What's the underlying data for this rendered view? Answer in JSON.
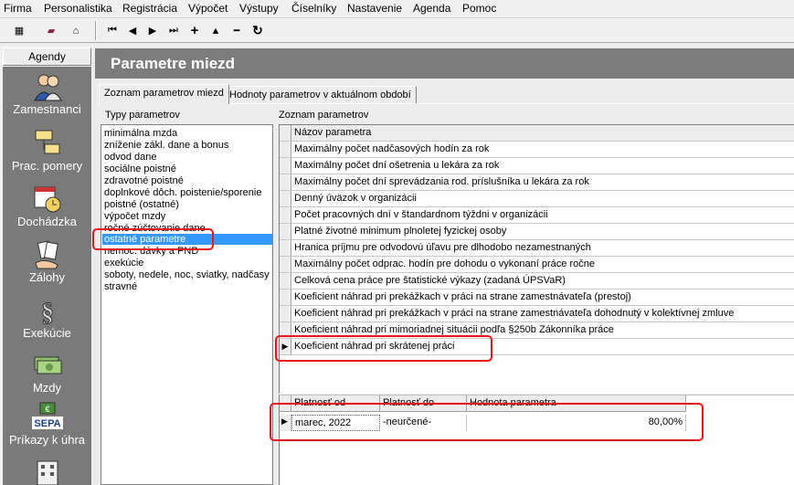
{
  "menu": [
    "Firma",
    "Personalistika",
    "Registrácia",
    "Výpočet",
    "Výstupy",
    "Číselníky",
    "Nastavenie",
    "Agenda",
    "Pomoc"
  ],
  "toolbar": {
    "icons": [
      "calculator-icon",
      "book-icon",
      "home-icon",
      "first-record-icon",
      "prev-record-icon",
      "next-record-icon",
      "last-record-icon",
      "add-icon",
      "up-icon",
      "delete-icon",
      "refresh-icon"
    ],
    "glyphs": [
      "▦",
      "▰",
      "⌂",
      "⏮",
      "◀",
      "▶",
      "⏭",
      "+",
      "▲",
      "━",
      "↻"
    ]
  },
  "sidebar": {
    "header": "Agendy",
    "items": [
      {
        "label": "Zamestnanci",
        "icon": "people-icon"
      },
      {
        "label": "Prac. pomery",
        "icon": "org-chart-icon"
      },
      {
        "label": "Dochádzka",
        "icon": "calendar-clock-icon"
      },
      {
        "label": "Zálohy",
        "icon": "cards-hand-icon"
      },
      {
        "label": "Exekúcie",
        "icon": "paragraph-icon"
      },
      {
        "label": "Mzdy",
        "icon": "money-icon"
      },
      {
        "label": "Príkazy k úhra",
        "icon": "sepa-icon"
      }
    ],
    "sepa_text": "SEPA"
  },
  "page_title": "Parametre miezd",
  "tabs": [
    "Zoznam parametrov miezd",
    "Hodnoty parametrov v aktuálnom období"
  ],
  "types_label": "Typy parametrov",
  "types": [
    "minimálna mzda",
    "zníženie zákl. dane a bonus",
    "odvod dane",
    "sociálne poistné",
    "zdravotné poistné",
    "doplnkové dôch. poistenie/sporenie",
    "poistné (ostatné)",
    "výpočet mzdy",
    "ročné zúčtovanie dane",
    "ostatné parametre",
    "nemoc. dávky a PND",
    "exekúcie",
    "soboty, nedele, noc, sviatky, nadčasy",
    "stravné"
  ],
  "types_selected": "ostatné parametre",
  "params_label": "Zoznam parametrov",
  "params_header": "Názov parametra",
  "params": [
    "Maximálny počet nadčasových hodín za rok",
    "Maximálny počet dní ošetrenia u lekára za rok",
    "Maximálny počet dní sprevádzania rod. príslušníka u lekára za rok",
    "Denný úväzok v organizácii",
    "Počet pracovných dní v štandardnom týždni v organizácii",
    "Platné životné minimum plnoletej fyzickej osoby",
    "Hranica príjmu pre odvodovú úľavu pre dlhodobo nezamestnaných",
    "Maximálny počet odprac. hodín pre dohodu o vykonaní práce ročne",
    "Celková cena práce pre štatistické výkazy (zadaná ÚPSVaR)",
    "Koeficient náhrad pri prekážkach v práci na strane zamestnávateľa (prestoj)",
    "Koeficient náhrad pri prekážkach v práci na strane zamestnávateľa dohodnutý v kolektívnej zmluve",
    "Koeficient náhrad pri mimoriadnej situácii podľa §250b Zákonníka práce",
    "Koeficient náhrad pri skrátenej práci"
  ],
  "row_pointer": "▶",
  "values_table": {
    "headers": [
      "Platnosť od",
      "Platnosť do",
      "Hodnota parametra"
    ],
    "row": {
      "from": "marec, 2022",
      "to": "-neurčené-",
      "value": "80,00%"
    }
  }
}
